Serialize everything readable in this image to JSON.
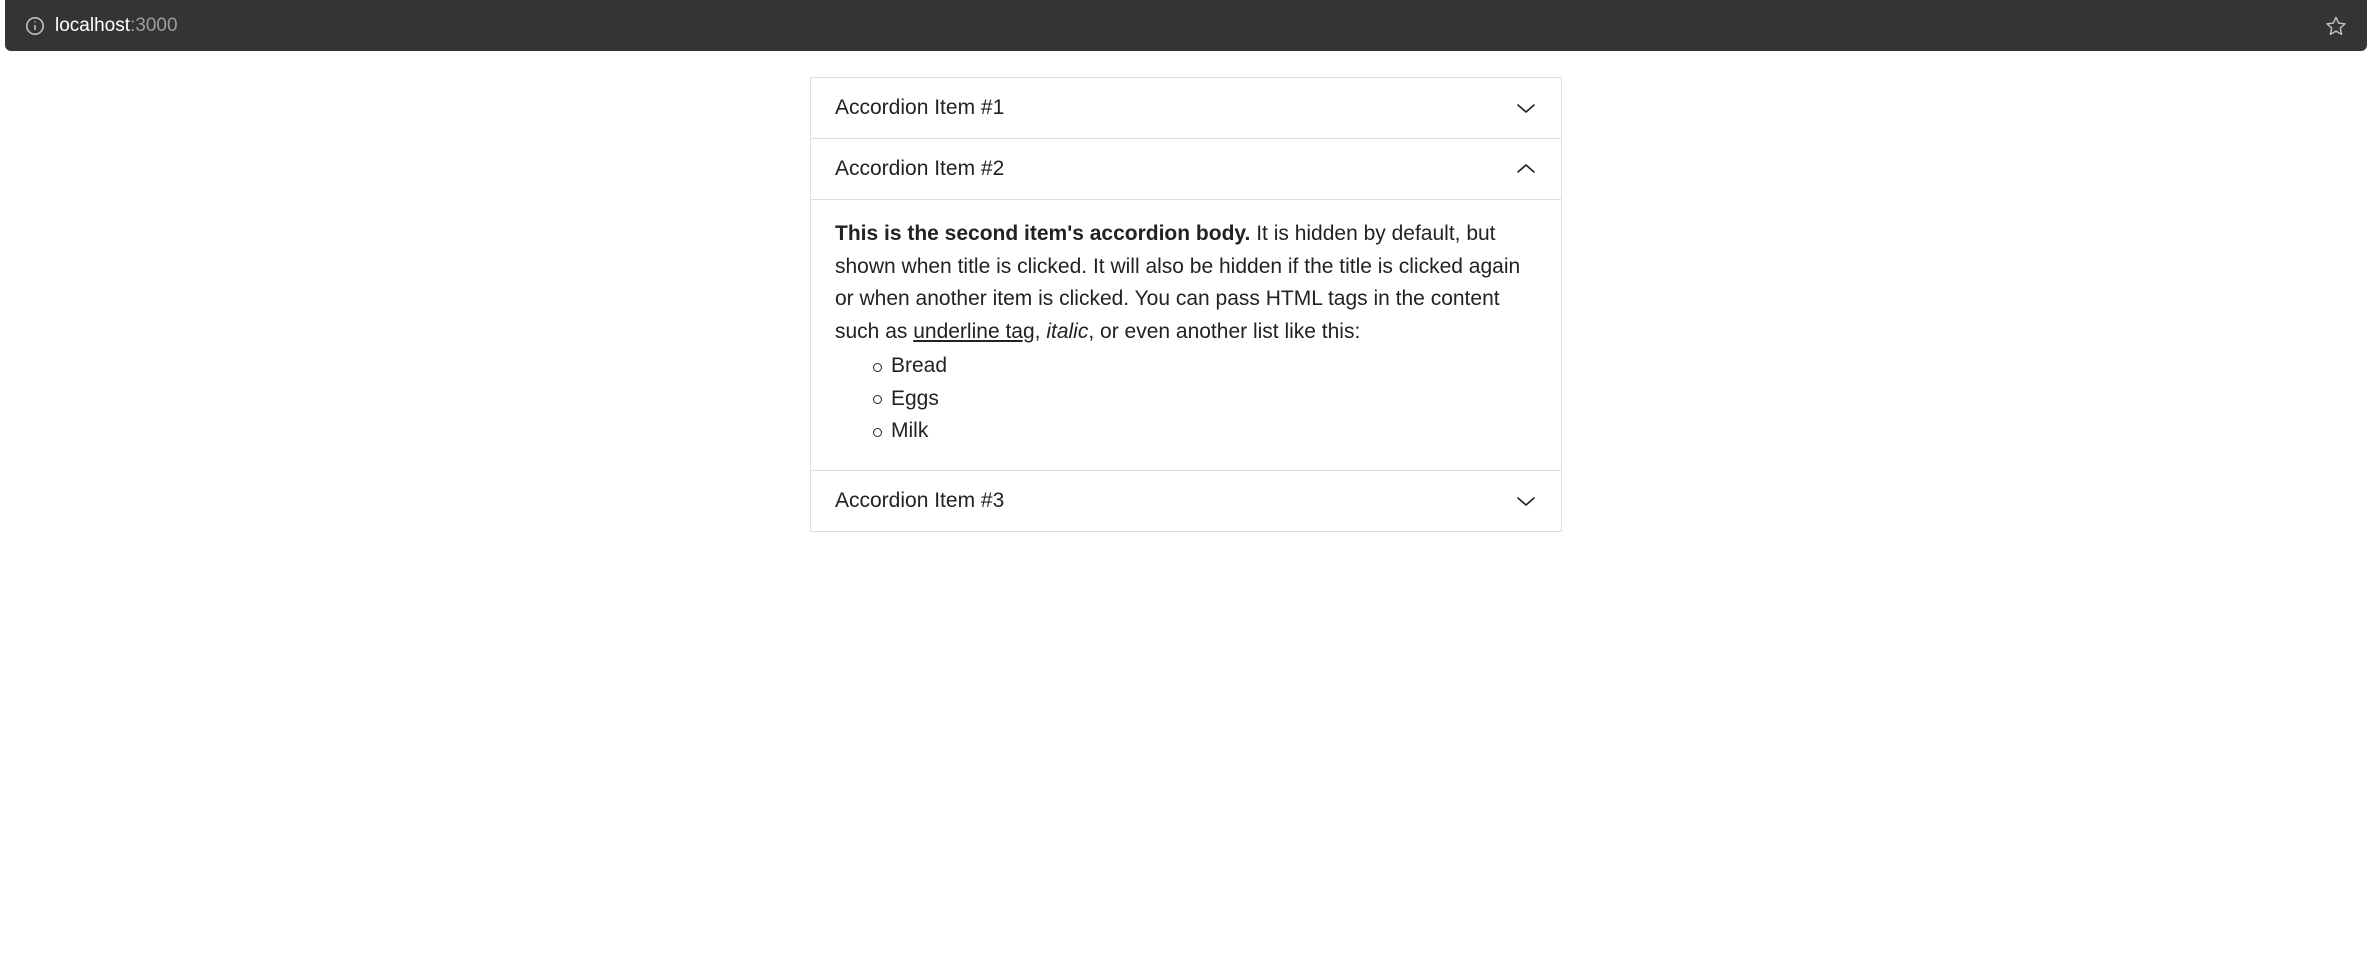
{
  "browser": {
    "url_host": "localhost",
    "url_port": ":3000"
  },
  "accordion": {
    "items": [
      {
        "title": "Accordion Item #1",
        "expanded": false
      },
      {
        "title": "Accordion Item #2",
        "expanded": true
      },
      {
        "title": "Accordion Item #3",
        "expanded": false
      }
    ],
    "body2": {
      "bold": "This is the second item's accordion body.",
      "text1": " It is hidden by default, but shown when title is clicked. It will also be hidden if the title is clicked again or when another item is clicked. You can pass HTML tags in the content such as ",
      "underline": "underline tag",
      "text2": ", ",
      "italic": "italic",
      "text3": ", or even another list like this:",
      "list": [
        "Bread",
        "Eggs",
        "Milk"
      ]
    }
  }
}
